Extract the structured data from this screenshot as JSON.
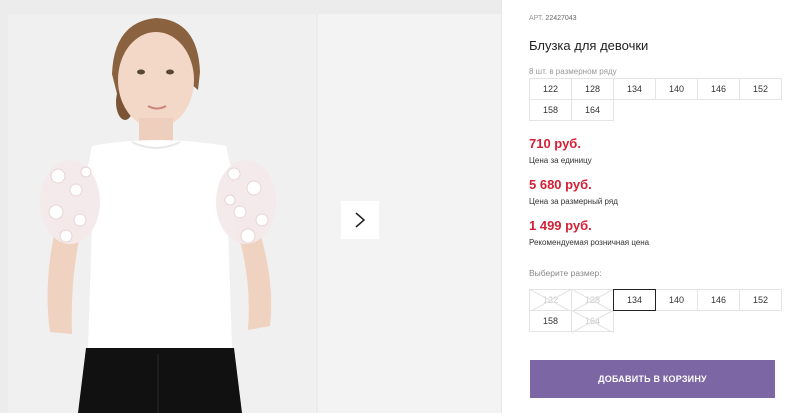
{
  "product": {
    "sku_label": "АРТ.",
    "sku": "22427043",
    "title": "Блузка для девочки",
    "row_count": "8 шт. в размерном ряду",
    "row_sizes": [
      "122",
      "128",
      "134",
      "140",
      "146",
      "152",
      "158",
      "164"
    ]
  },
  "gallery": {
    "photo_alt": "Девочка в белой блузке с объёмными рукавами",
    "next_icon": "chevron-right-icon"
  },
  "prices": [
    {
      "value": "710 руб.",
      "caption": "Цена за единицу"
    },
    {
      "value": "5 680 руб.",
      "caption": "Цена за размерный ряд"
    },
    {
      "value": "1 499 руб.",
      "caption": "Рекомендуемая розничная цена"
    }
  ],
  "size_select": {
    "label": "Выберите размер:",
    "selected": "134",
    "options": [
      {
        "size": "122",
        "available": false
      },
      {
        "size": "128",
        "available": false
      },
      {
        "size": "134",
        "available": true
      },
      {
        "size": "140",
        "available": true
      },
      {
        "size": "146",
        "available": true
      },
      {
        "size": "152",
        "available": true
      },
      {
        "size": "158",
        "available": true
      },
      {
        "size": "164",
        "available": false
      }
    ]
  },
  "cart": {
    "button_label": "ДОБАВИТЬ В КОРЗИНУ"
  },
  "colors": {
    "price": "#d22136",
    "accent": "#7c66a4"
  }
}
